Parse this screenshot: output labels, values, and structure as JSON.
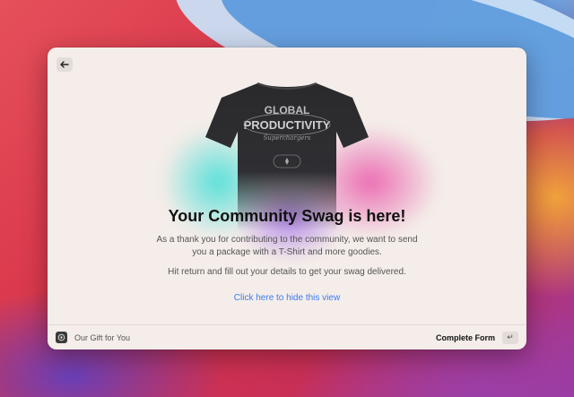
{
  "window": {
    "headline": "Your Community Swag is here!",
    "description_line1": "As a thank you for contributing to the community, we want to send",
    "description_line2": "you a package with a T-Shirt and more goodies.",
    "instruction": "Hit return and fill out your details to get your swag delivered.",
    "hide_link": "Click here to hide this view",
    "back_icon": "arrow-left-icon"
  },
  "shirt": {
    "line1": "GLOBAL",
    "line2": "PRODUCTIVITY",
    "line3": "Superchargers"
  },
  "footer": {
    "title": "Our Gift for You",
    "action_label": "Complete Form",
    "action_key": "↵"
  },
  "colors": {
    "accent_link": "#3b7cf0",
    "window_bg": "#f4ede9"
  }
}
